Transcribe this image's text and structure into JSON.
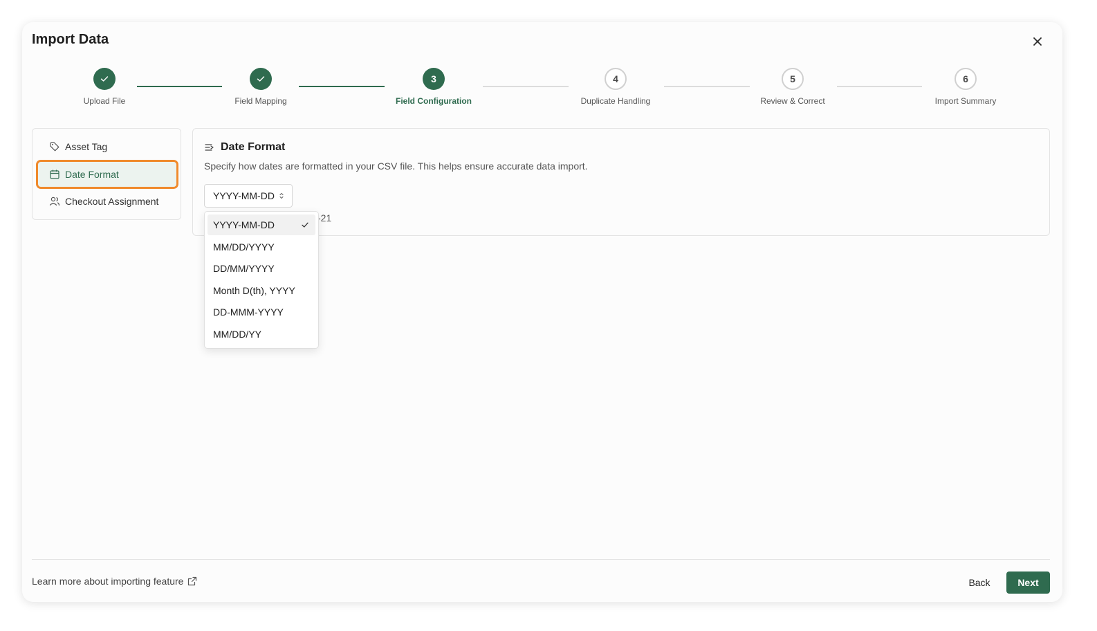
{
  "modal": {
    "title": "Import Data"
  },
  "stepper": {
    "steps": [
      {
        "number": "1",
        "label": "Upload File",
        "status": "completed"
      },
      {
        "number": "2",
        "label": "Field Mapping",
        "status": "completed"
      },
      {
        "number": "3",
        "label": "Field Configuration",
        "status": "active"
      },
      {
        "number": "4",
        "label": "Duplicate Handling",
        "status": "pending"
      },
      {
        "number": "5",
        "label": "Review & Correct",
        "status": "pending"
      },
      {
        "number": "6",
        "label": "Import Summary",
        "status": "pending"
      }
    ]
  },
  "sidebar": {
    "items": [
      {
        "label": "Asset Tag",
        "icon": "tag-icon"
      },
      {
        "label": "Date Format",
        "icon": "calendar-icon",
        "selected": true
      },
      {
        "label": "Checkout Assignment",
        "icon": "users-icon"
      }
    ]
  },
  "panel": {
    "icon": "list-arrow-icon",
    "title": "Date Format",
    "description": "Specify how dates are formatted in your CSV file. This helps ensure accurate data import.",
    "selected_format": "YYYY-MM-DD",
    "preview_partial": "-21"
  },
  "dropdown": {
    "options": [
      "YYYY-MM-DD",
      "MM/DD/YYYY",
      "DD/MM/YYYY",
      "Month D(th), YYYY",
      "DD-MMM-YYYY",
      "MM/DD/YY"
    ],
    "selected": "YYYY-MM-DD"
  },
  "footer": {
    "learn_more": "Learn more about importing feature",
    "back_label": "Back",
    "next_label": "Next"
  },
  "colors": {
    "primary": "#2f6b4f",
    "highlight": "#f08a2c",
    "pending_border": "#d0d0d0"
  }
}
